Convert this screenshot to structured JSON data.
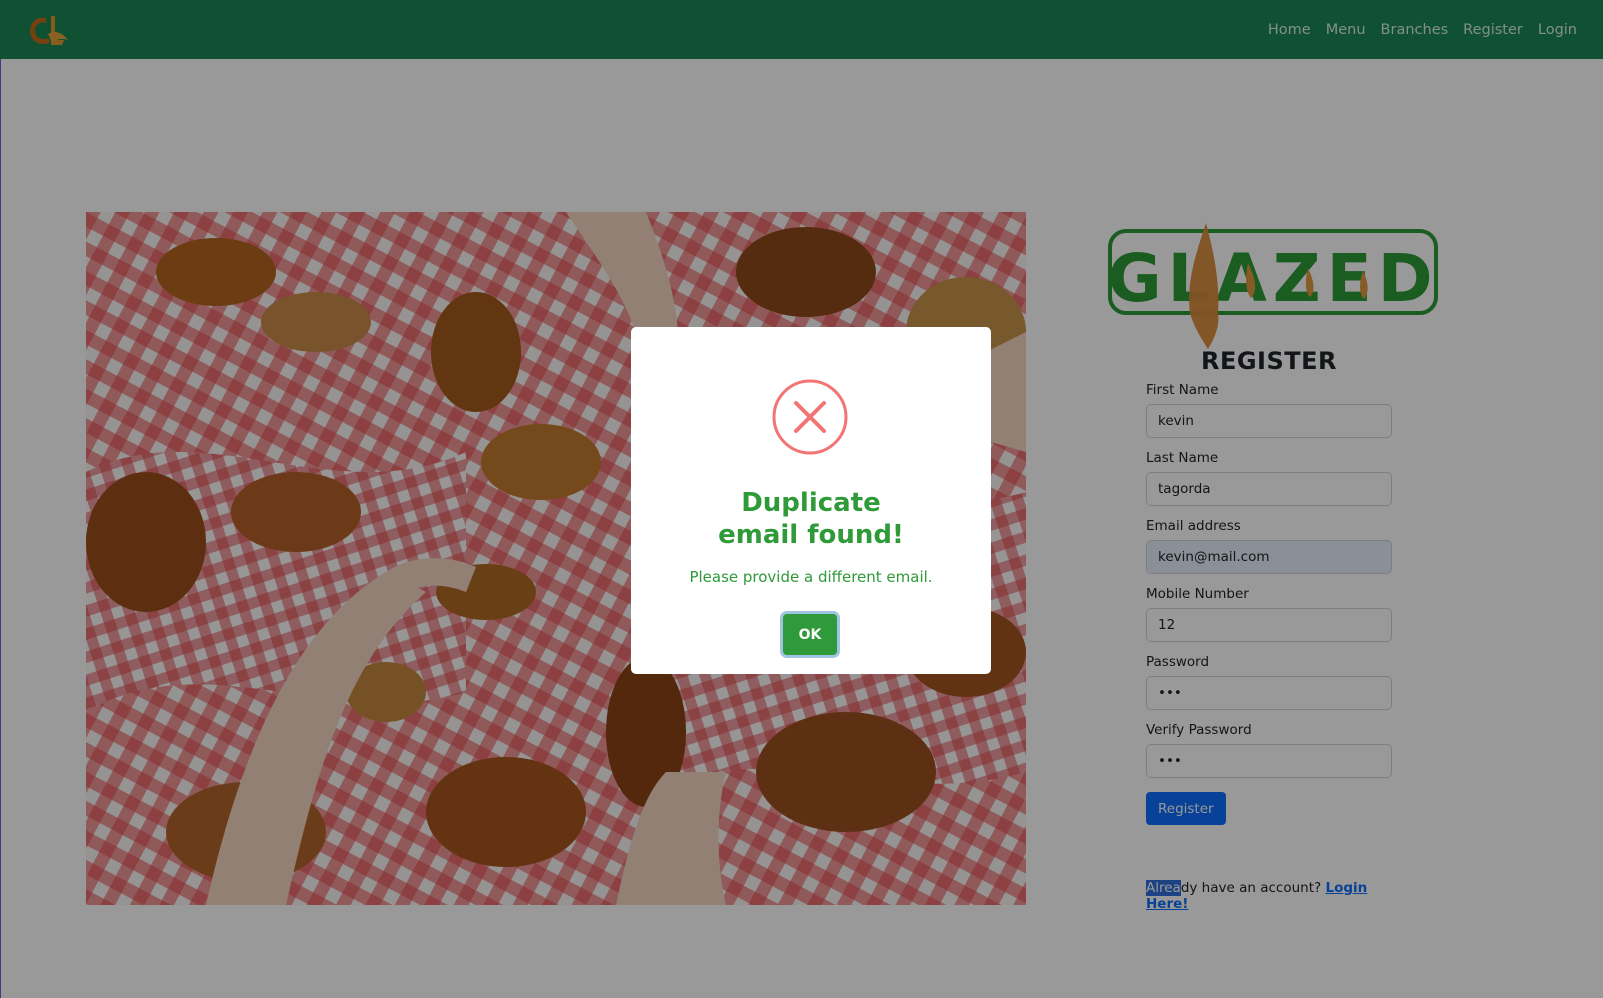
{
  "nav": {
    "links": [
      "Home",
      "Menu",
      "Branches",
      "Register",
      "Login"
    ]
  },
  "logo": {
    "text": "GLAZED"
  },
  "register": {
    "title": "REGISTER",
    "fields": [
      {
        "label": "First Name",
        "value": "kevin"
      },
      {
        "label": "Last Name",
        "value": "tagorda"
      },
      {
        "label": "Email address",
        "value": "kevin@mail.com"
      },
      {
        "label": "Mobile Number",
        "value": "12"
      },
      {
        "label": "Password",
        "value": "•••"
      },
      {
        "label": "Verify Password",
        "value": "•••"
      }
    ],
    "submit_label": "Register",
    "account_prefix_selected": "Alrea",
    "account_prefix_rest": "dy have an account?",
    "login_link": "Login Here!"
  },
  "modal": {
    "title": "Duplicate email found!",
    "message": "Please provide a different email.",
    "ok_label": "OK",
    "icon": "error-x-icon"
  },
  "colors": {
    "navbar": "#198754",
    "primary": "#0d6efd",
    "modal_text": "#2e9a38",
    "error_icon": "#f27474"
  }
}
